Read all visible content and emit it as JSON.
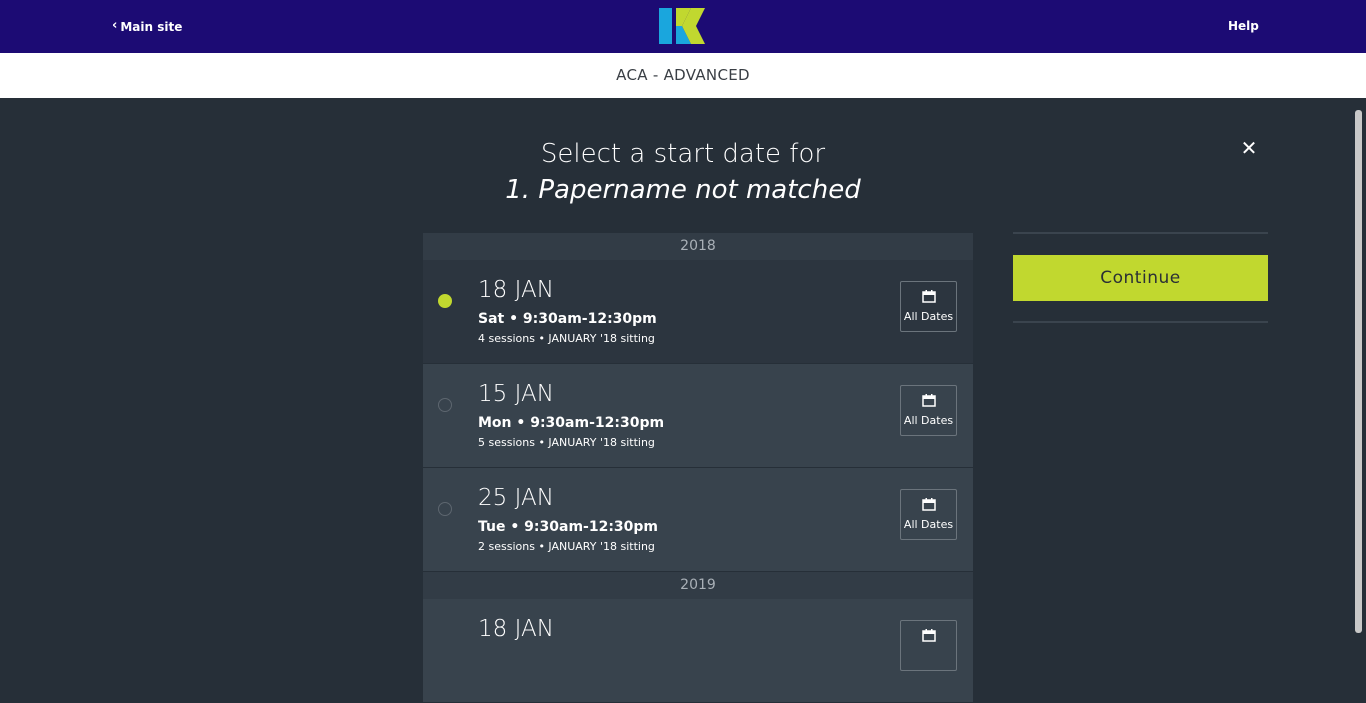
{
  "header": {
    "back_label": "Main site",
    "help_label": "Help",
    "logo_colors": {
      "left": "#1aa6dd",
      "right": "#c1d82f"
    }
  },
  "course_title": "ACA - ADVANCED",
  "dialog": {
    "title_line1": "Select a start date for",
    "title_line2": "1. Papername not matched",
    "continue_label": "Continue"
  },
  "groups": [
    {
      "year": "2018",
      "items": [
        {
          "date": "18 JAN",
          "time": "Sat • 9:30am-12:30pm",
          "meta": "4 sessions • JANUARY '18 sitting",
          "all_dates": "All Dates",
          "selected": true
        },
        {
          "date": "15 JAN",
          "time": "Mon • 9:30am-12:30pm",
          "meta": "5 sessions • JANUARY '18 sitting",
          "all_dates": "All Dates",
          "selected": false
        },
        {
          "date": "25 JAN",
          "time": "Tue • 9:30am-12:30pm",
          "meta": "2 sessions • JANUARY '18 sitting",
          "all_dates": "All Dates",
          "selected": false
        }
      ]
    },
    {
      "year": "2019",
      "items": [
        {
          "date": "18 JAN",
          "time": "",
          "meta": "",
          "all_dates": "",
          "selected": false
        }
      ]
    }
  ],
  "colors": {
    "topbar": "#1c0b74",
    "background": "#262f38",
    "accent": "#c1d82f"
  }
}
